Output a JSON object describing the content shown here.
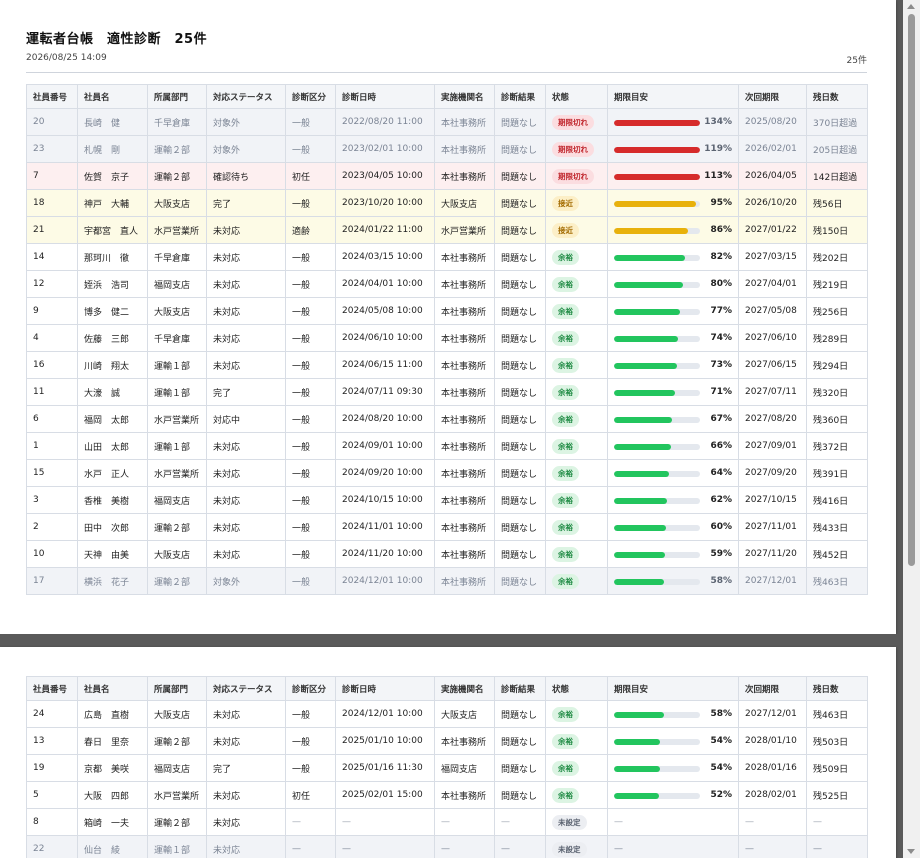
{
  "title": "運転者台帳　適性診断　25件",
  "generated_at": "2026/08/25 14:09",
  "count_label": "25件",
  "columns": [
    "社員番号",
    "社員名",
    "所属部門",
    "対応ステータス",
    "診断区分",
    "診断日時",
    "実施機関名",
    "診断結果",
    "状態",
    "期限目安",
    "次回期限",
    "残日数"
  ],
  "badge_labels": {
    "expired": "期限切れ",
    "near": "接近",
    "ok": "余裕",
    "unset": "未設定"
  },
  "colors": {
    "expired": "#d62b2b",
    "near": "#e8b10c",
    "ok": "#22c55e"
  },
  "page1_rows": [
    {
      "id": "20",
      "name": "長崎　健",
      "dept": "千早倉庫",
      "status": "対象外",
      "kind": "一般",
      "date": "2022/08/20 11:00",
      "org": "本社事務所",
      "result": "問題なし",
      "state": "expired",
      "pct": 134,
      "pct_label": "134%",
      "next": "2025/08/20",
      "remain": "370日超過",
      "style": "muted"
    },
    {
      "id": "23",
      "name": "札幌　剛",
      "dept": "運輸２部",
      "status": "対象外",
      "kind": "一般",
      "date": "2023/02/01 10:00",
      "org": "本社事務所",
      "result": "問題なし",
      "state": "expired",
      "pct": 119,
      "pct_label": "119%",
      "next": "2026/02/01",
      "remain": "205日超過",
      "style": "muted"
    },
    {
      "id": "7",
      "name": "佐賀　京子",
      "dept": "運輸２部",
      "status": "確認待ち",
      "kind": "初任",
      "date": "2023/04/05 10:00",
      "org": "本社事務所",
      "result": "問題なし",
      "state": "expired",
      "pct": 113,
      "pct_label": "113%",
      "next": "2026/04/05",
      "remain": "142日超過",
      "style": "expired"
    },
    {
      "id": "18",
      "name": "神戸　大輔",
      "dept": "大阪支店",
      "status": "完了",
      "kind": "一般",
      "date": "2023/10/20 10:00",
      "org": "大阪支店",
      "result": "問題なし",
      "state": "near",
      "pct": 95,
      "pct_label": "95%",
      "next": "2026/10/20",
      "remain": "残56日",
      "style": "near"
    },
    {
      "id": "21",
      "name": "宇都宮　直人",
      "dept": "水戸営業所",
      "status": "未対応",
      "kind": "適齢",
      "date": "2024/01/22 11:00",
      "org": "水戸営業所",
      "result": "問題なし",
      "state": "near",
      "pct": 86,
      "pct_label": "86%",
      "next": "2027/01/22",
      "remain": "残150日",
      "style": "near"
    },
    {
      "id": "14",
      "name": "那珂川　徹",
      "dept": "千早倉庫",
      "status": "未対応",
      "kind": "一般",
      "date": "2024/03/15 10:00",
      "org": "本社事務所",
      "result": "問題なし",
      "state": "ok",
      "pct": 82,
      "pct_label": "82%",
      "next": "2027/03/15",
      "remain": "残202日",
      "style": "normal"
    },
    {
      "id": "12",
      "name": "姪浜　浩司",
      "dept": "福岡支店",
      "status": "未対応",
      "kind": "一般",
      "date": "2024/04/01 10:00",
      "org": "本社事務所",
      "result": "問題なし",
      "state": "ok",
      "pct": 80,
      "pct_label": "80%",
      "next": "2027/04/01",
      "remain": "残219日",
      "style": "normal"
    },
    {
      "id": "9",
      "name": "博多　健二",
      "dept": "大阪支店",
      "status": "未対応",
      "kind": "一般",
      "date": "2024/05/08 10:00",
      "org": "本社事務所",
      "result": "問題なし",
      "state": "ok",
      "pct": 77,
      "pct_label": "77%",
      "next": "2027/05/08",
      "remain": "残256日",
      "style": "normal"
    },
    {
      "id": "4",
      "name": "佐藤　三郎",
      "dept": "千早倉庫",
      "status": "未対応",
      "kind": "一般",
      "date": "2024/06/10 10:00",
      "org": "本社事務所",
      "result": "問題なし",
      "state": "ok",
      "pct": 74,
      "pct_label": "74%",
      "next": "2027/06/10",
      "remain": "残289日",
      "style": "normal"
    },
    {
      "id": "16",
      "name": "川崎　翔太",
      "dept": "運輸１部",
      "status": "未対応",
      "kind": "一般",
      "date": "2024/06/15 11:00",
      "org": "本社事務所",
      "result": "問題なし",
      "state": "ok",
      "pct": 73,
      "pct_label": "73%",
      "next": "2027/06/15",
      "remain": "残294日",
      "style": "normal"
    },
    {
      "id": "11",
      "name": "大濠　誠",
      "dept": "運輸１部",
      "status": "完了",
      "kind": "一般",
      "date": "2024/07/11 09:30",
      "org": "本社事務所",
      "result": "問題なし",
      "state": "ok",
      "pct": 71,
      "pct_label": "71%",
      "next": "2027/07/11",
      "remain": "残320日",
      "style": "normal"
    },
    {
      "id": "6",
      "name": "福岡　太郎",
      "dept": "水戸営業所",
      "status": "対応中",
      "kind": "一般",
      "date": "2024/08/20 10:00",
      "org": "本社事務所",
      "result": "問題なし",
      "state": "ok",
      "pct": 67,
      "pct_label": "67%",
      "next": "2027/08/20",
      "remain": "残360日",
      "style": "normal"
    },
    {
      "id": "1",
      "name": "山田　太郎",
      "dept": "運輸１部",
      "status": "未対応",
      "kind": "一般",
      "date": "2024/09/01 10:00",
      "org": "本社事務所",
      "result": "問題なし",
      "state": "ok",
      "pct": 66,
      "pct_label": "66%",
      "next": "2027/09/01",
      "remain": "残372日",
      "style": "normal"
    },
    {
      "id": "15",
      "name": "水戸　正人",
      "dept": "水戸営業所",
      "status": "未対応",
      "kind": "一般",
      "date": "2024/09/20 10:00",
      "org": "本社事務所",
      "result": "問題なし",
      "state": "ok",
      "pct": 64,
      "pct_label": "64%",
      "next": "2027/09/20",
      "remain": "残391日",
      "style": "normal"
    },
    {
      "id": "3",
      "name": "香椎　美樹",
      "dept": "福岡支店",
      "status": "未対応",
      "kind": "一般",
      "date": "2024/10/15 10:00",
      "org": "本社事務所",
      "result": "問題なし",
      "state": "ok",
      "pct": 62,
      "pct_label": "62%",
      "next": "2027/10/15",
      "remain": "残416日",
      "style": "normal"
    },
    {
      "id": "2",
      "name": "田中　次郎",
      "dept": "運輸２部",
      "status": "未対応",
      "kind": "一般",
      "date": "2024/11/01 10:00",
      "org": "本社事務所",
      "result": "問題なし",
      "state": "ok",
      "pct": 60,
      "pct_label": "60%",
      "next": "2027/11/01",
      "remain": "残433日",
      "style": "normal"
    },
    {
      "id": "10",
      "name": "天神　由美",
      "dept": "大阪支店",
      "status": "未対応",
      "kind": "一般",
      "date": "2024/11/20 10:00",
      "org": "本社事務所",
      "result": "問題なし",
      "state": "ok",
      "pct": 59,
      "pct_label": "59%",
      "next": "2027/11/20",
      "remain": "残452日",
      "style": "normal"
    },
    {
      "id": "17",
      "name": "横浜　花子",
      "dept": "運輸２部",
      "status": "対象外",
      "kind": "一般",
      "date": "2024/12/01 10:00",
      "org": "本社事務所",
      "result": "問題なし",
      "state": "ok",
      "pct": 58,
      "pct_label": "58%",
      "next": "2027/12/01",
      "remain": "残463日",
      "style": "muted"
    }
  ],
  "page2_rows": [
    {
      "id": "24",
      "name": "広島　直樹",
      "dept": "大阪支店",
      "status": "未対応",
      "kind": "一般",
      "date": "2024/12/01 10:00",
      "org": "大阪支店",
      "result": "問題なし",
      "state": "ok",
      "pct": 58,
      "pct_label": "58%",
      "next": "2027/12/01",
      "remain": "残463日",
      "style": "normal"
    },
    {
      "id": "13",
      "name": "春日　里奈",
      "dept": "運輸２部",
      "status": "未対応",
      "kind": "一般",
      "date": "2025/01/10 10:00",
      "org": "本社事務所",
      "result": "問題なし",
      "state": "ok",
      "pct": 54,
      "pct_label": "54%",
      "next": "2028/01/10",
      "remain": "残503日",
      "style": "normal"
    },
    {
      "id": "19",
      "name": "京都　美咲",
      "dept": "福岡支店",
      "status": "完了",
      "kind": "一般",
      "date": "2025/01/16 11:30",
      "org": "福岡支店",
      "result": "問題なし",
      "state": "ok",
      "pct": 54,
      "pct_label": "54%",
      "next": "2028/01/16",
      "remain": "残509日",
      "style": "normal"
    },
    {
      "id": "5",
      "name": "大阪　四郎",
      "dept": "水戸営業所",
      "status": "未対応",
      "kind": "初任",
      "date": "2025/02/01 15:00",
      "org": "本社事務所",
      "result": "問題なし",
      "state": "ok",
      "pct": 52,
      "pct_label": "52%",
      "next": "2028/02/01",
      "remain": "残525日",
      "style": "normal"
    },
    {
      "id": "8",
      "name": "箱崎　一夫",
      "dept": "運輸２部",
      "status": "未対応",
      "kind": "—",
      "date": "—",
      "org": "—",
      "result": "—",
      "state": "unset",
      "pct": null,
      "pct_label": "—",
      "next": "—",
      "remain": "—",
      "style": "normal"
    },
    {
      "id": "22",
      "name": "仙台　綾",
      "dept": "運輸１部",
      "status": "未対応",
      "kind": "—",
      "date": "—",
      "org": "—",
      "result": "—",
      "state": "unset",
      "pct": null,
      "pct_label": "—",
      "next": "—",
      "remain": "—",
      "style": "muted"
    }
  ]
}
